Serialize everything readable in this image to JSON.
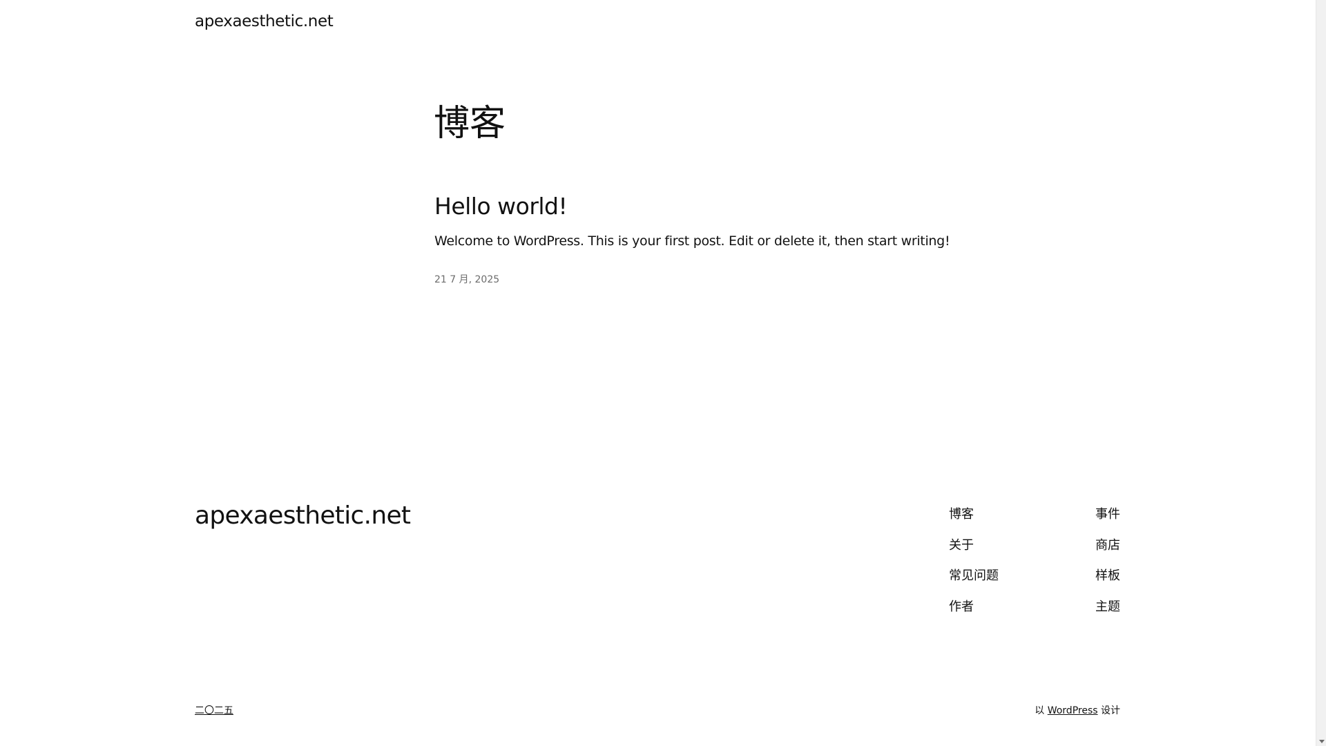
{
  "header": {
    "site_title": "apexaesthetic.net"
  },
  "main": {
    "page_heading": "博客",
    "post": {
      "title": "Hello world!",
      "excerpt": "Welcome to WordPress. This is your first post. Edit or delete it, then start writing!",
      "date": "21 7 月, 2025"
    }
  },
  "footer": {
    "site_title": "apexaesthetic.net",
    "nav_left": [
      "博客",
      "关于",
      "常见问题",
      "作者"
    ],
    "nav_right": [
      "事件",
      "商店",
      "样板",
      "主题"
    ],
    "year": "二〇二五",
    "credit_prefix": "以",
    "credit_link": "WordPress",
    "credit_suffix": "设计"
  },
  "colors": {
    "text": "#111111",
    "muted": "#6b6b6b",
    "background": "#ffffff"
  }
}
